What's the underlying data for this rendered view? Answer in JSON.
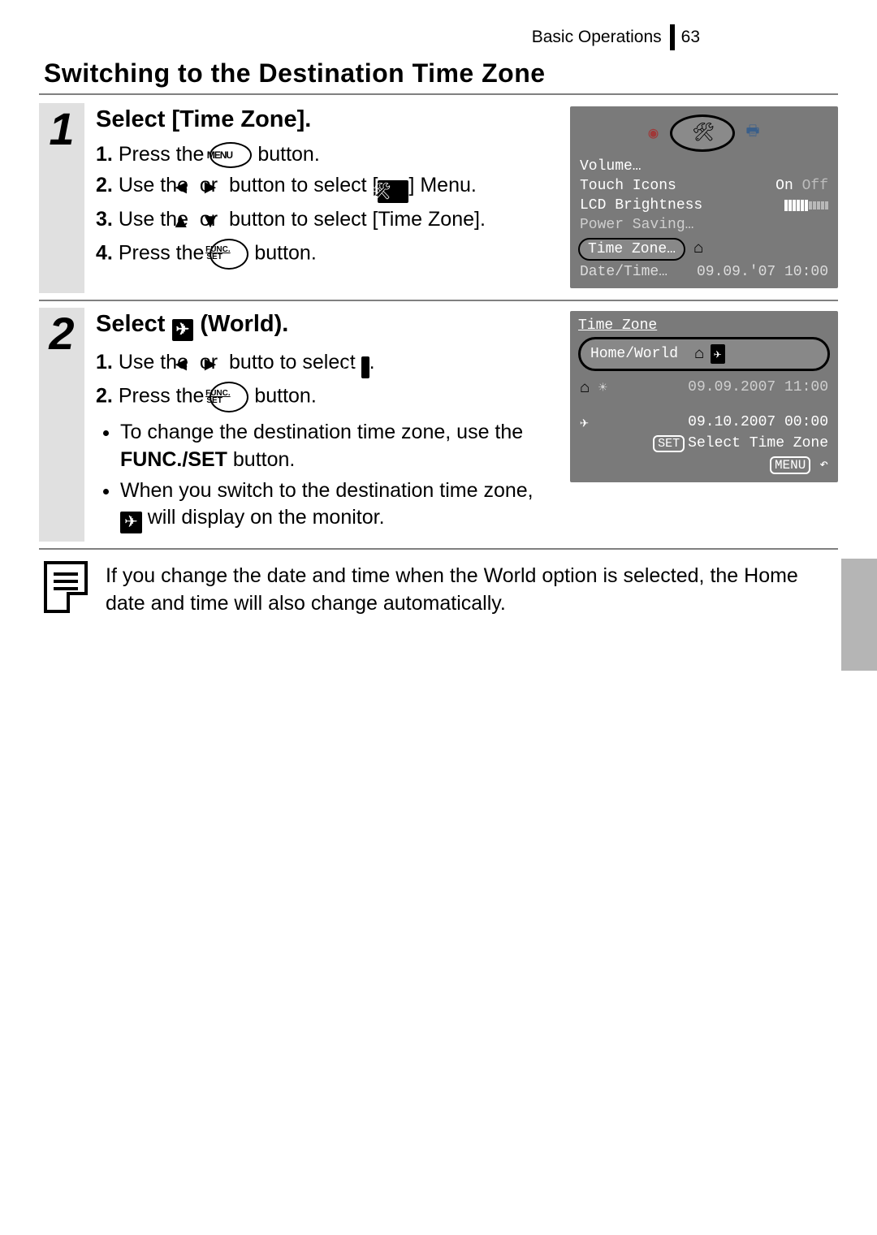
{
  "header": {
    "breadcrumb": "Basic Operations",
    "page_number": "63"
  },
  "title": "Switching to the Destination Time Zone",
  "steps": [
    {
      "num": "1",
      "heading": "Select [Time Zone].",
      "items": [
        {
          "pre": "1.",
          "a": "Press the ",
          "btn": "MENU",
          "b": " button."
        },
        {
          "pre": "2.",
          "a": "Use the ",
          "arrows": "lr",
          "b": " button to select [",
          "tools": true,
          "c": "] Menu."
        },
        {
          "pre": "3.",
          "a": "Use the ",
          "arrows": "ud",
          "b": " button to select [Time Zone]."
        },
        {
          "pre": "4.",
          "a": "Press the ",
          "btn": "FUNCSET",
          "b": " button."
        }
      ],
      "screen": {
        "rows": {
          "volume": "Volume…",
          "touch_icons": "Touch Icons",
          "touch_icons_val_on": "On",
          "touch_icons_val_off": "Off",
          "lcd_brightness": "LCD Brightness",
          "power_saving": "Power Saving…",
          "time_zone": "Time Zone…",
          "date_time": "Date/Time…",
          "date_time_val": "09.09.'07 10:00"
        }
      }
    },
    {
      "num": "2",
      "heading_pre": "Select ",
      "heading_post": " (World).",
      "items2": [
        {
          "pre": "1.",
          "a": "Use the ",
          "arrows": "lr",
          "b": " butto to select ",
          "world": true,
          "c": "."
        },
        {
          "pre": "2.",
          "a": "Press the ",
          "btn": "FUNCSET",
          "b": " button."
        }
      ],
      "bullets": [
        {
          "a": "To change the destination time zone, use the ",
          "bold": "FUNC./SET",
          "b": " button."
        },
        {
          "a": "When you switch to the destination time zone, ",
          "world": true,
          "b": " will display on the monitor."
        }
      ],
      "screen2": {
        "title": "Time Zone",
        "home_world": "Home/World",
        "home_date": "09.09.2007 11:00",
        "world_date": "09.10.2007 00:00",
        "select_tz": "Select Time Zone",
        "set": "SET",
        "menu": "MENU"
      }
    }
  ],
  "note": "If you change the date and time when the World option is selected, the Home date and time will also change automatically."
}
